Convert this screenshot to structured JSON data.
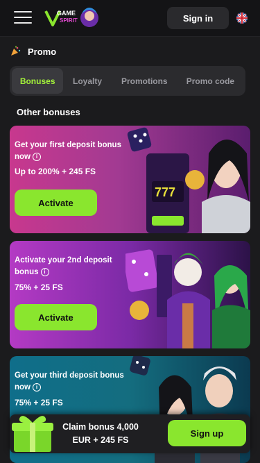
{
  "header": {
    "signin_label": "Sign in",
    "logo_text": "Game Spirit"
  },
  "promo": {
    "title": "Promo"
  },
  "tabs": [
    {
      "label": "Bonuses"
    },
    {
      "label": "Loyalty"
    },
    {
      "label": "Promotions"
    },
    {
      "label": "Promo code"
    }
  ],
  "other": {
    "title": "Other bonuses"
  },
  "cards": [
    {
      "text": "Get your first deposit bonus now",
      "value": "Up to 200% + 245 FS",
      "button": "Activate"
    },
    {
      "text": "Activate your 2nd deposit bonus",
      "value": "75% + 25 FS",
      "button": "Activate"
    },
    {
      "text": "Get your third deposit bonus now",
      "value": "75% + 25 FS"
    }
  ],
  "bottom": {
    "claim": "Claim bonus 4,000 EUR + 245 FS",
    "signup_label": "Sign up"
  },
  "colors": {
    "accent": "#8ae62e",
    "tab_active_text": "#a4f23a",
    "background": "#1b1b1d",
    "header": "#141416"
  }
}
